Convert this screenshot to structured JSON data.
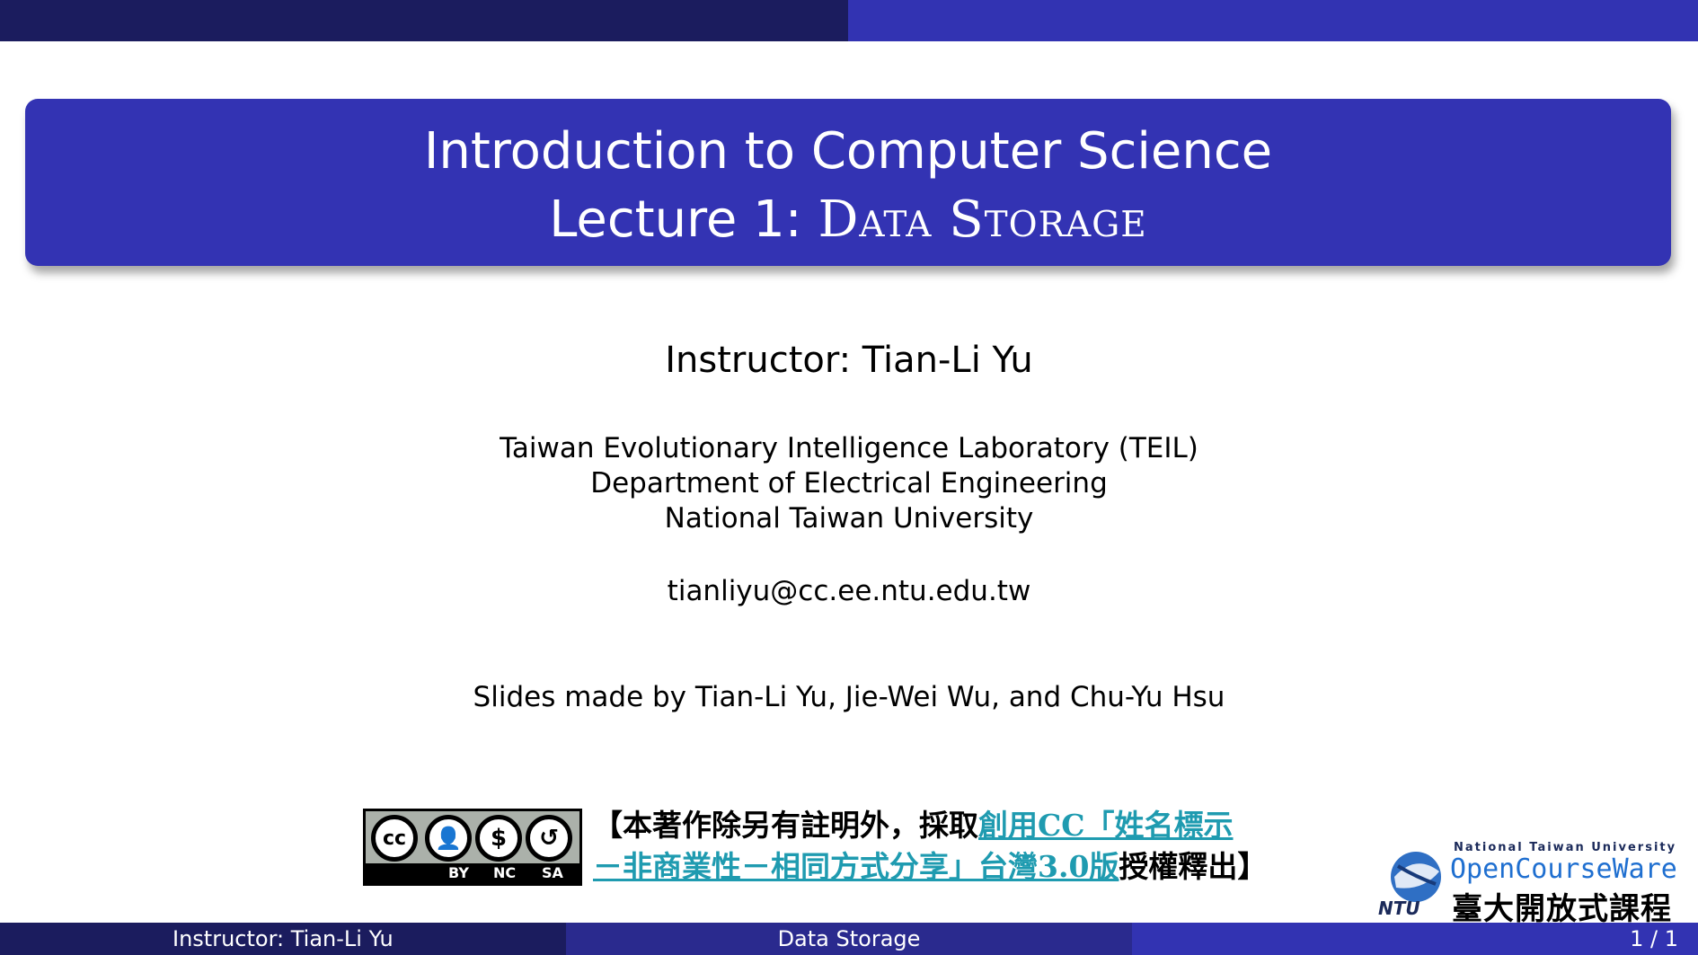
{
  "title": {
    "line1": "Introduction to Computer Science",
    "line2_prefix": "Lecture 1:",
    "line2_topic": "Data Storage"
  },
  "instructor": "Instructor: Tian-Li Yu",
  "affiliation": [
    "Taiwan Evolutionary Intelligence Laboratory (TEIL)",
    "Department of Electrical Engineering",
    "National Taiwan University"
  ],
  "email": "tianliyu@cc.ee.ntu.edu.tw",
  "credits": "Slides made by Tian-Li Yu, Jie-Wei Wu, and Chu-Yu Hsu",
  "license": {
    "badge_labels": [
      "BY",
      "NC",
      "SA"
    ],
    "prefix": "【本著作除另有註明外，採取",
    "link_text_line1": "創用CC「姓名標示",
    "link_text_line2": "－非商業性－相同方式分享」台灣3.0版",
    "suffix": "授權釋出】"
  },
  "ocw_logo": {
    "top_text": "National Taiwan University",
    "brand": "OpenCourseWare",
    "chinese": "臺大開放式課程",
    "ntu": "NTU"
  },
  "footer": {
    "left": "Instructor: Tian-Li Yu",
    "center": "Data Storage",
    "right": "1 / 1"
  },
  "colors": {
    "dark_navy": "#1b1c5e",
    "title_blue": "#3333b3",
    "link_teal": "#1f9bb0"
  }
}
